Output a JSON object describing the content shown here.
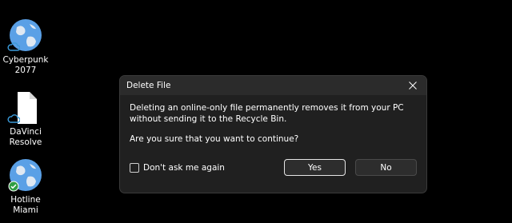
{
  "desktop": {
    "icons": [
      {
        "label_line1": "Cyberpunk",
        "label_line2": "2077",
        "icon": "globe-icon",
        "overlay": "cloud-icon"
      },
      {
        "label_line1": "DaVinci",
        "label_line2": "Resolve",
        "icon": "blank-file-icon",
        "overlay": "cloud-icon"
      },
      {
        "label_line1": "Hotline",
        "label_line2": "Miami",
        "icon": "globe-icon",
        "overlay": "synced-check-icon"
      }
    ]
  },
  "dialog": {
    "title": "Delete File",
    "message": "Deleting an online-only file permanently removes it from your PC without sending it to the Recycle Bin.",
    "question": "Are you sure that you want to continue?",
    "checkbox_label": "Don't ask me again",
    "checkbox_checked": false,
    "yes_label": "Yes",
    "no_label": "No"
  },
  "colors": {
    "background": "#000000",
    "dialog_bg": "#202020",
    "titlebar_bg": "#2b2b2b",
    "globe_blue": "#4a90d9"
  }
}
